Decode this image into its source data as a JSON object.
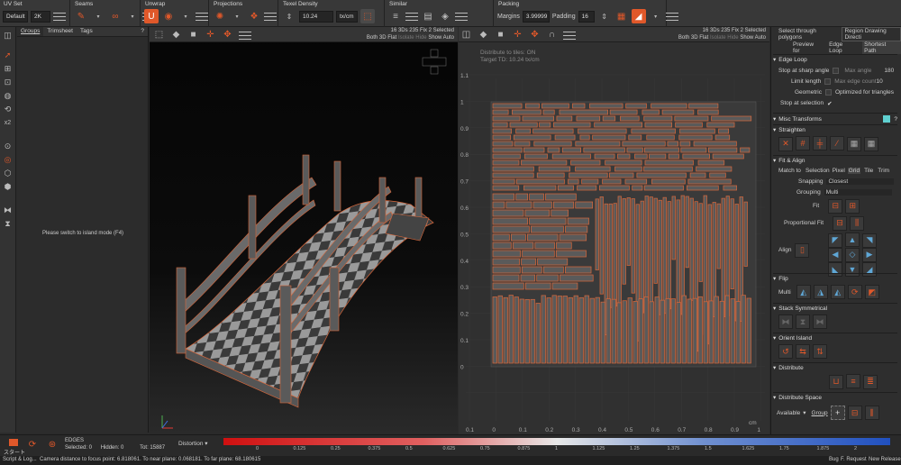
{
  "topbar": {
    "uvset": {
      "title": "UV Set",
      "default": "Default",
      "res": "2K"
    },
    "seams": {
      "title": "Seams"
    },
    "unwrap": {
      "title": "Unwrap"
    },
    "projections": {
      "title": "Projections"
    },
    "texel": {
      "title": "Texel Density",
      "value": "10.24",
      "unit": "tx/cm"
    },
    "similar": {
      "title": "Similar"
    },
    "packing": {
      "title": "Packing",
      "margins_label": "Margins",
      "margins_value": "3.99999",
      "padding_label": "Padding",
      "padding_value": "16"
    }
  },
  "groups": {
    "tabs": [
      "Groups",
      "Trimsheet",
      "Tags"
    ],
    "help": "?",
    "message": "Please switch to island mode (F4)"
  },
  "viewport3d": {
    "stats_line1": "16 3Ds 235 Fix 2 Selected",
    "stats_line2_a": "Both 3D Flat",
    "stats_line2_b": "Isolate Hide",
    "stats_line2_c": "Show Auto"
  },
  "viewportuv": {
    "stats_line1": "16 3Ds 235 Fix 2 Selected",
    "stats_line2_a": "Both 3D Flat",
    "stats_line2_b": "Isolate Hide",
    "stats_line2_c": "Show Auto",
    "distribute": "Distribute to tiles: ON",
    "target": "Target TD: 10.24 tx/cm",
    "yticks": [
      "1.1",
      "1",
      "0.9",
      "0.8",
      "0.7",
      "0.6",
      "0.5",
      "0.4",
      "0.3",
      "0.2",
      "0.1",
      "0"
    ],
    "xticks": [
      "0.1",
      "0",
      "0.1",
      "0.2",
      "0.3",
      "0.4",
      "0.5",
      "0.6",
      "0.7",
      "0.8",
      "0.9",
      "1",
      "1.1"
    ],
    "unit": "cm"
  },
  "rightpanel": {
    "select_through": "Select through polygons",
    "region": "Region Drawing Directi",
    "preview_for": "Preview for",
    "edge_loop_tab": "Edge Loop",
    "shortest_path": "Shortest Path",
    "edge_loop_hdr": "Edge Loop",
    "stop_sharp": "Stop at sharp angle",
    "max_angle": "Max angle",
    "max_angle_val": "180",
    "limit_length": "Limit length",
    "max_edge_count": "Max edge count",
    "max_edge_count_val": "10",
    "geometric": "Geometric",
    "optimized": "Optimized for triangles",
    "stop_selection": "Stop at selection",
    "misc": "Misc Transforms",
    "straighten": "Straighten",
    "fit_align": "Fit & Align",
    "match_to": "Match to",
    "match_opts": [
      "Selection",
      "Pixel",
      "Grid",
      "Tile",
      "Trim"
    ],
    "snapping": "Snapping",
    "snapping_val": "Closest",
    "grouping": "Grouping",
    "grouping_val": "Multi",
    "fit": "Fit",
    "prop_fit": "Proportional Fit",
    "align": "Align",
    "flip": "Flip",
    "multi": "Multi",
    "stack_sym": "Stack Symmetrical",
    "orient": "Orient Island",
    "distribute": "Distribute",
    "dist_space": "Distribute Space",
    "available": "Available",
    "group": "Group"
  },
  "bottom": {
    "mode": "EDGES",
    "selected": "Selected: 0",
    "hidden": "Hidden: 0",
    "total": "Tot: 15887",
    "start": "スタート",
    "distortion": "Distortion",
    "scale": [
      "0",
      "0.125",
      "0.25",
      "0.375",
      "0.5",
      "0.625",
      "0.75",
      "0.875",
      "1",
      "1.125",
      "1.25",
      "1.375",
      "1.5",
      "1.625",
      "1.75",
      "1.875",
      "2"
    ]
  },
  "status": {
    "left": "Script & Log...",
    "message": "Camera distance to focus point: 6.818061. To near plane: 0.068181. To far plane: 68.180615",
    "bug": "Bug",
    "freq": "F. Request",
    "release": "New Release"
  },
  "colors": {
    "accent": "#e0582a",
    "uvline": "#d9673a"
  },
  "icons": [
    "select-arrow-icon",
    "pin-icon",
    "magnet-icon",
    "cube-icon",
    "gear-icon"
  ]
}
